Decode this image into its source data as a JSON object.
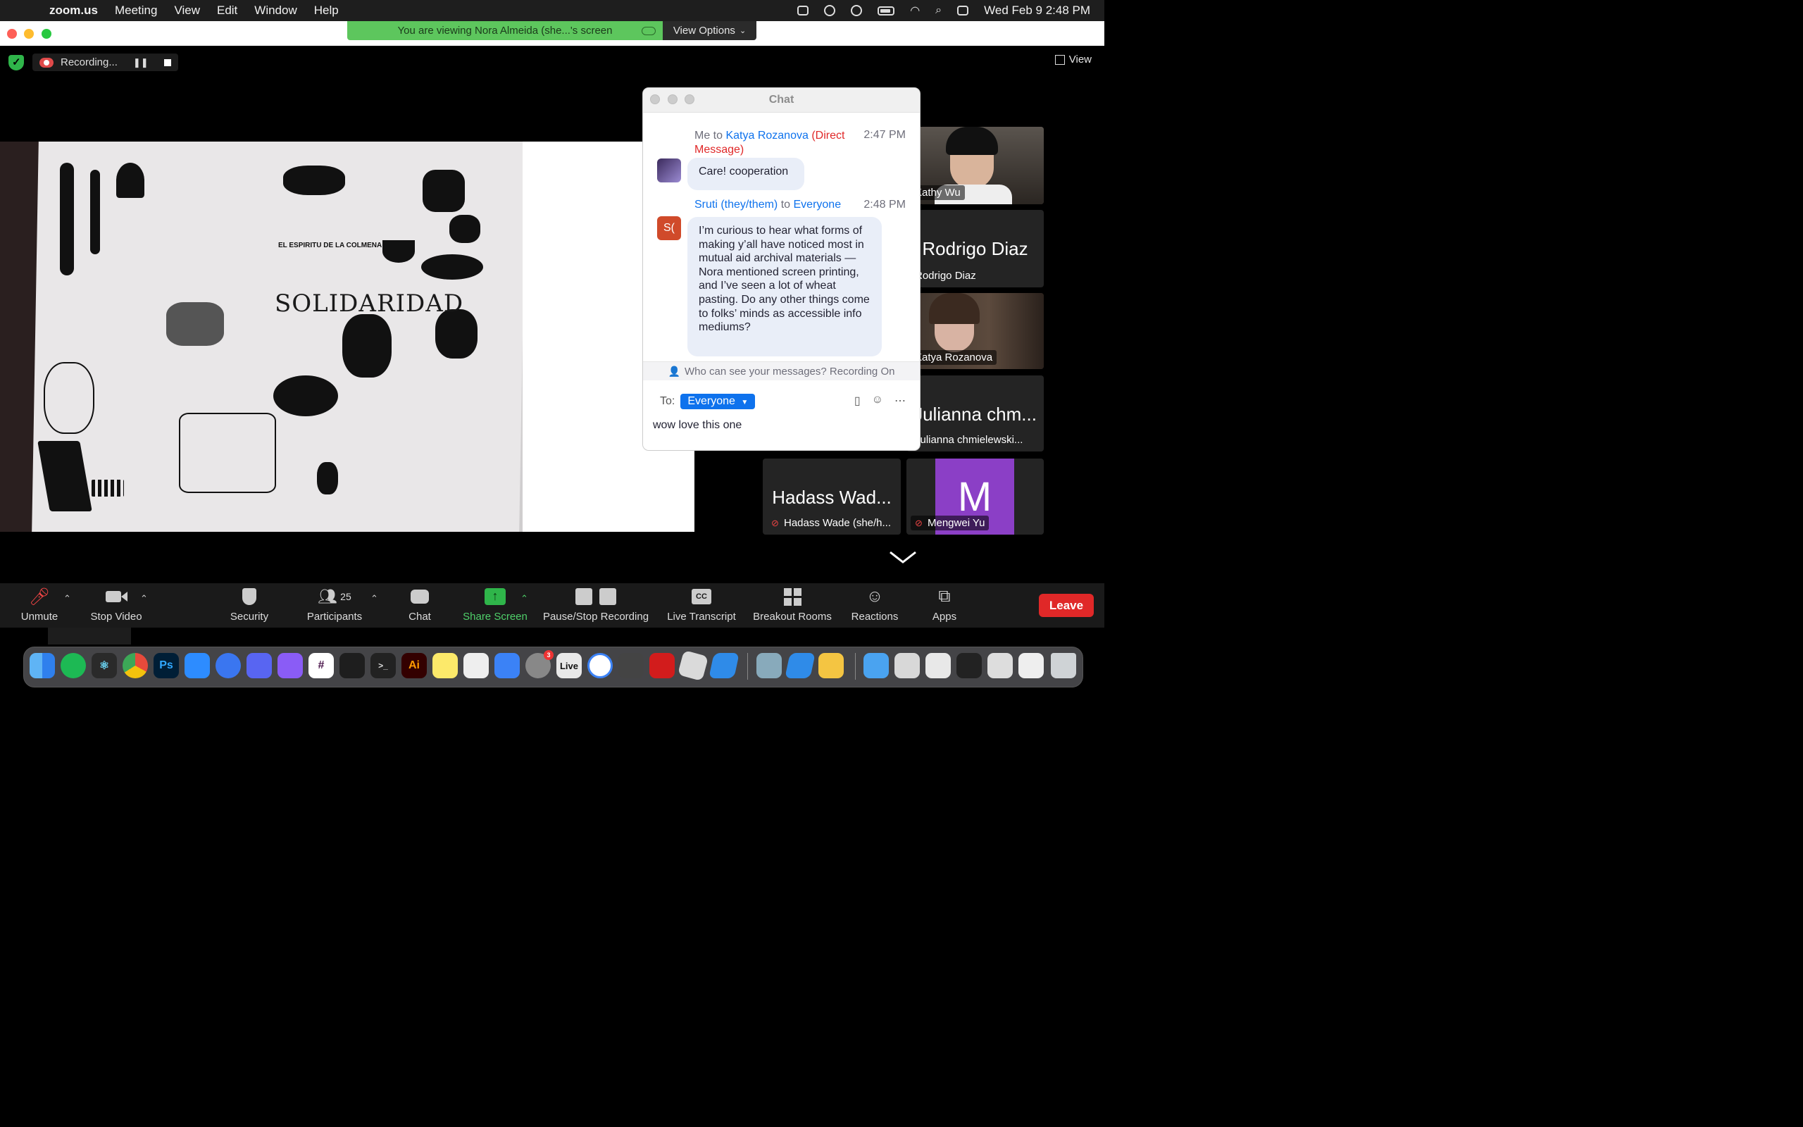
{
  "menubar": {
    "app_name": "zoom.us",
    "menus": [
      "Meeting",
      "View",
      "Edit",
      "Window",
      "Help"
    ],
    "clock": "Wed Feb 9  2:48 PM"
  },
  "banner": {
    "viewing_text": "You are viewing Nora Almeida (she...'s screen",
    "view_options": "View Options"
  },
  "meeting": {
    "recording_label": "Recording...",
    "view_label": "View"
  },
  "artwork": {
    "solidaridad": "SOLIDARIDAD",
    "espiritu": "EL ESPIRITU DE LA COLMENA"
  },
  "participants": [
    {
      "name": "Kathy Wu",
      "big": ""
    },
    {
      "name": "Rodrigo Diaz",
      "big": "Rodrigo Diaz"
    },
    {
      "name": "Katya Rozanova",
      "big": ""
    },
    {
      "name": "Julianna chmielewski...",
      "big": "Julianna chm..."
    },
    {
      "name": "Hadass Wade (she/h...",
      "big": "Hadass Wad..."
    },
    {
      "name": "Mengwei Yu",
      "big": "M"
    }
  ],
  "chat": {
    "title": "Chat",
    "msg1": {
      "prefix": "Me to ",
      "to": "Katya Rozanova",
      "dm1": "(Direct",
      "dm2": "Message)",
      "time": "2:47 PM",
      "text": "Care! cooperation"
    },
    "msg2": {
      "from": "Sruti (they/them)",
      "mid": " to ",
      "to": "Everyone",
      "time": "2:48 PM",
      "avatar": "S(",
      "text": "I’m curious to hear what forms of making y’all have noticed most in mutual aid archival materials — Nora mentioned screen printing, and I’ve seen a lot of wheat pasting. Do any other things come to folks’ minds as accessible info mediums?"
    },
    "visibility": "Who can see your messages? Recording On",
    "to_label": "To:",
    "to_value": "Everyone",
    "input_value": "wow love this one"
  },
  "toolbar": {
    "unmute": "Unmute",
    "stop_video": "Stop Video",
    "security": "Security",
    "participants": "Participants",
    "participants_count": "25",
    "chat": "Chat",
    "share_screen": "Share Screen",
    "pause_stop": "Pause/Stop Recording",
    "live_transcript": "Live Transcript",
    "breakout": "Breakout Rooms",
    "reactions": "Reactions",
    "apps": "Apps",
    "leave": "Leave"
  },
  "dock": {
    "ps": "Ps",
    "ai": "Ai",
    "live": "Live",
    "badge": "3"
  },
  "colors": {
    "zoom_blue": "#0e72ed",
    "leave_red": "#e02828",
    "banner_green": "#5dc65d",
    "share_green": "#2fb54a"
  }
}
